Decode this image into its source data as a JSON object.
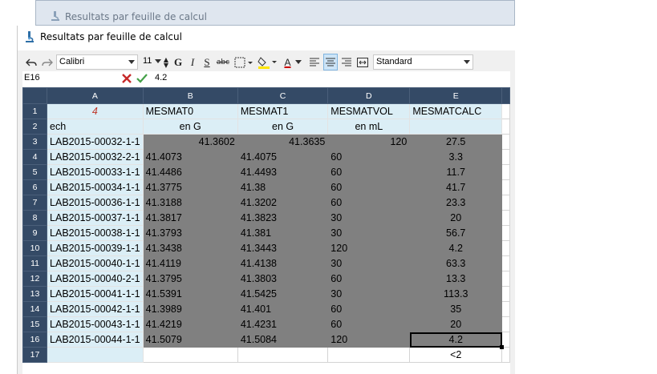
{
  "background_window": {
    "title": "Resultats par feuille de calcul"
  },
  "main_window": {
    "title": "Resultats par feuille de calcul"
  },
  "toolbar": {
    "font_name": "Calibri",
    "font_size": "11",
    "bold_label": "G",
    "italic_label": "I",
    "underline_label": "S",
    "strike_label": "abc",
    "font_color_label": "A",
    "number_format": "Standard"
  },
  "formula_bar": {
    "cell_ref": "E16",
    "value": "4.2"
  },
  "grid": {
    "columns": [
      "A",
      "B",
      "C",
      "D",
      "E"
    ],
    "row_numbers": [
      "1",
      "2",
      "3",
      "4",
      "5",
      "6",
      "7",
      "8",
      "9",
      "10",
      "11",
      "12",
      "13",
      "14",
      "15",
      "16",
      "17"
    ],
    "header_row": [
      "4",
      "MESMAT0",
      "MESMAT1",
      "MESMATVOL",
      "MESMATCALC"
    ],
    "unit_row": [
      "ech",
      "en G",
      "en G",
      "en mL",
      ""
    ],
    "data_rows": [
      [
        "LAB2015-00032-1-1",
        "41.3602",
        "41.3635",
        "120",
        "27.5"
      ],
      [
        "LAB2015-00032-2-1",
        "41.4073",
        "41.4075",
        "60",
        "3.3"
      ],
      [
        "LAB2015-00033-1-1",
        "41.4486",
        "41.4493",
        "60",
        "11.7"
      ],
      [
        "LAB2015-00034-1-1",
        "41.3775",
        "41.38",
        "60",
        "41.7"
      ],
      [
        "LAB2015-00036-1-1",
        "41.3188",
        "41.3202",
        "60",
        "23.3"
      ],
      [
        "LAB2015-00037-1-1",
        "41.3817",
        "41.3823",
        "30",
        "20"
      ],
      [
        "LAB2015-00038-1-1",
        "41.3793",
        "41.381",
        "30",
        "56.7"
      ],
      [
        "LAB2015-00039-1-1",
        "41.3438",
        "41.3443",
        "120",
        "4.2"
      ],
      [
        "LAB2015-00040-1-1",
        "41.4119",
        "41.4138",
        "30",
        "63.3"
      ],
      [
        "LAB2015-00040-2-1",
        "41.3795",
        "41.3803",
        "60",
        "13.3"
      ],
      [
        "LAB2015-00041-1-1",
        "41.5391",
        "41.5425",
        "30",
        "113.3"
      ],
      [
        "LAB2015-00042-1-1",
        "41.3989",
        "41.401",
        "60",
        "35"
      ],
      [
        "LAB2015-00043-1-1",
        "41.4219",
        "41.4231",
        "60",
        "20"
      ],
      [
        "LAB2015-00044-1-1",
        "41.5079",
        "41.5084",
        "120",
        "4.2"
      ]
    ],
    "row17": [
      "",
      "",
      "",
      "",
      "<2"
    ]
  }
}
